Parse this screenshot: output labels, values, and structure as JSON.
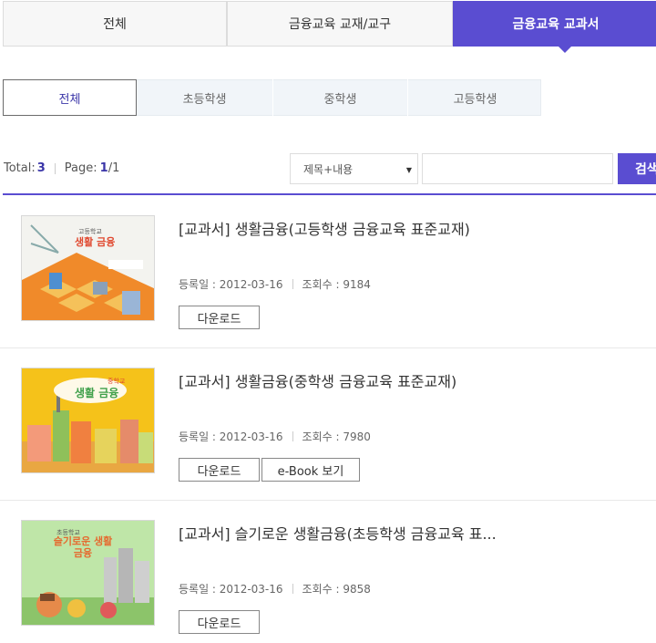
{
  "top_tabs": [
    {
      "label": "전체"
    },
    {
      "label": "금융교육 교재/교구"
    },
    {
      "label": "금융교육 교과서"
    }
  ],
  "sub_tabs": [
    {
      "label": "전체"
    },
    {
      "label": "초등학생"
    },
    {
      "label": "중학생"
    },
    {
      "label": "고등학생"
    }
  ],
  "summary": {
    "total_label": "Total:",
    "total_value": "3",
    "page_label": "Page:",
    "page_current": "1",
    "page_total": "/1"
  },
  "search": {
    "select_value": "제목+내용",
    "input_value": "",
    "button_label": "검색"
  },
  "items": [
    {
      "title": "[교과서] 생활금융(고등학생 금융교육 표준교재)",
      "date": "등록일 : 2012-03-16",
      "views": "조회수 : 9184",
      "thumb_text_small": "고등학교",
      "thumb_text_big": "생활 금융",
      "buttons": [
        "다운로드"
      ]
    },
    {
      "title": "[교과서] 생활금융(중학생 금융교육 표준교재)",
      "date": "등록일 : 2012-03-16",
      "views": "조회수 : 7980",
      "thumb_text_small": "중학교",
      "thumb_text_big": "생활 금융",
      "buttons": [
        "다운로드",
        "e-Book 보기"
      ]
    },
    {
      "title": "[교과서] 슬기로운 생활금융(초등학생 금융교육 표...",
      "date": "등록일 : 2012-03-16",
      "views": "조회수 : 9858",
      "thumb_text_small": "초등학교",
      "thumb_text_big": "슬기로운 생활 금융",
      "buttons": [
        "다운로드"
      ]
    }
  ],
  "colors": {
    "accent": "#5a4dd1",
    "accent_text": "#3a35a8"
  }
}
